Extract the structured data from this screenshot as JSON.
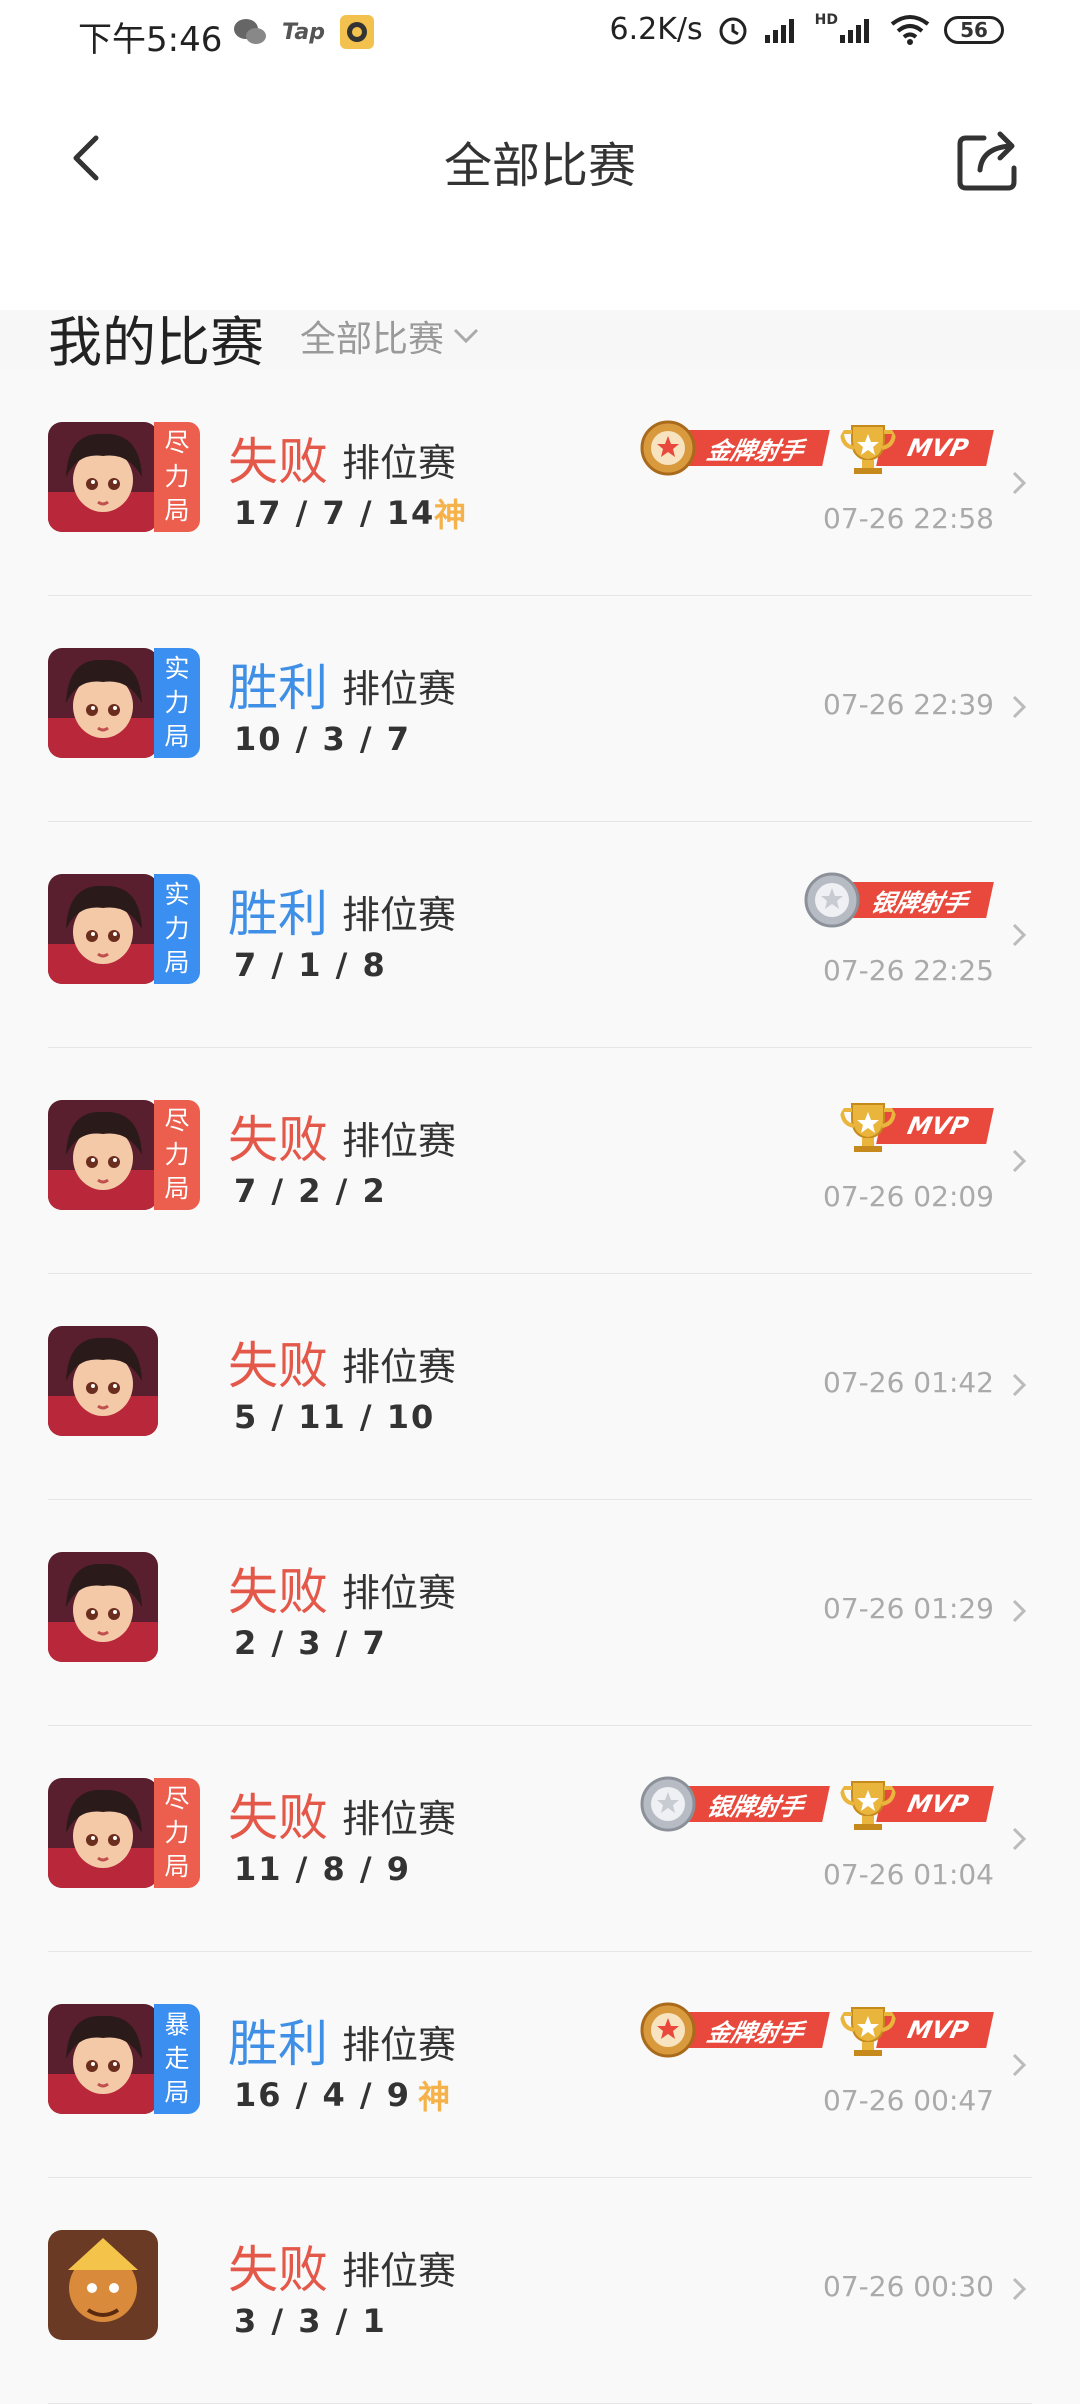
{
  "status_bar": {
    "time": "下午5:46",
    "app_icons": [
      "wechat-icon",
      "tap-icon",
      "game-app-icon"
    ],
    "tap_label": "Tap",
    "net_speed": "6.2K/s",
    "hd_label": "HD",
    "battery": "56"
  },
  "header": {
    "title": "全部比赛",
    "section_title": "我的比赛",
    "filter_label": "全部比赛"
  },
  "matches": [
    {
      "result": "失败",
      "outcome": "loss",
      "mode": "排位赛",
      "kda": "17 / 7 / 14",
      "god": "神",
      "time": "07-26 22:58",
      "tag": [
        "尽",
        "力",
        "局"
      ],
      "tag_color": "red",
      "avatar": "hero-girl",
      "badges": [
        {
          "type": "gold",
          "label": "金牌射手"
        },
        {
          "type": "mvp",
          "label": "MVP"
        }
      ]
    },
    {
      "result": "胜利",
      "outcome": "win",
      "mode": "排位赛",
      "kda": "10 / 3 / 7",
      "god": "",
      "time": "07-26 22:39",
      "tag": [
        "实",
        "力",
        "局"
      ],
      "tag_color": "blue",
      "avatar": "hero-girl",
      "badges": []
    },
    {
      "result": "胜利",
      "outcome": "win",
      "mode": "排位赛",
      "kda": "7 / 1 / 8",
      "god": "",
      "time": "07-26 22:25",
      "tag": [
        "实",
        "力",
        "局"
      ],
      "tag_color": "blue",
      "avatar": "hero-girl",
      "badges": [
        {
          "type": "silver",
          "label": "银牌射手"
        }
      ]
    },
    {
      "result": "失败",
      "outcome": "loss",
      "mode": "排位赛",
      "kda": "7 / 2 / 2",
      "god": "",
      "time": "07-26 02:09",
      "tag": [
        "尽",
        "力",
        "局"
      ],
      "tag_color": "red",
      "avatar": "hero-girl",
      "badges": [
        {
          "type": "mvp",
          "label": "MVP"
        }
      ]
    },
    {
      "result": "失败",
      "outcome": "loss",
      "mode": "排位赛",
      "kda": "5 / 11 / 10",
      "god": "",
      "time": "07-26 01:42",
      "tag": [],
      "tag_color": "",
      "avatar": "hero-girl",
      "badges": []
    },
    {
      "result": "失败",
      "outcome": "loss",
      "mode": "排位赛",
      "kda": "2 / 3 / 7",
      "god": "",
      "time": "07-26 01:29",
      "tag": [],
      "tag_color": "",
      "avatar": "hero-girl",
      "badges": []
    },
    {
      "result": "失败",
      "outcome": "loss",
      "mode": "排位赛",
      "kda": "11 / 8 / 9",
      "god": "",
      "time": "07-26 01:04",
      "tag": [
        "尽",
        "力",
        "局"
      ],
      "tag_color": "red",
      "avatar": "hero-girl",
      "badges": [
        {
          "type": "silver",
          "label": "银牌射手"
        },
        {
          "type": "mvp",
          "label": "MVP"
        }
      ]
    },
    {
      "result": "胜利",
      "outcome": "win",
      "mode": "排位赛",
      "kda": "16 / 4 / 9",
      "god": "神",
      "time": "07-26 00:47",
      "tag": [
        "暴",
        "走",
        "局"
      ],
      "tag_color": "blue",
      "avatar": "hero-girl",
      "badges": [
        {
          "type": "gold",
          "label": "金牌射手"
        },
        {
          "type": "mvp",
          "label": "MVP"
        }
      ]
    },
    {
      "result": "失败",
      "outcome": "loss",
      "mode": "排位赛",
      "kda": "3 / 3 / 1",
      "god": "",
      "time": "07-26 00:30",
      "tag": [],
      "tag_color": "",
      "avatar": "hero-monkey",
      "badges": []
    }
  ],
  "colors": {
    "loss": "#e4584a",
    "win": "#3f8fe6",
    "tag_red": "#ec5e4e",
    "tag_blue": "#3a8ff0",
    "badge_ribbon": "#e8493c",
    "god": "#f5b24a"
  }
}
